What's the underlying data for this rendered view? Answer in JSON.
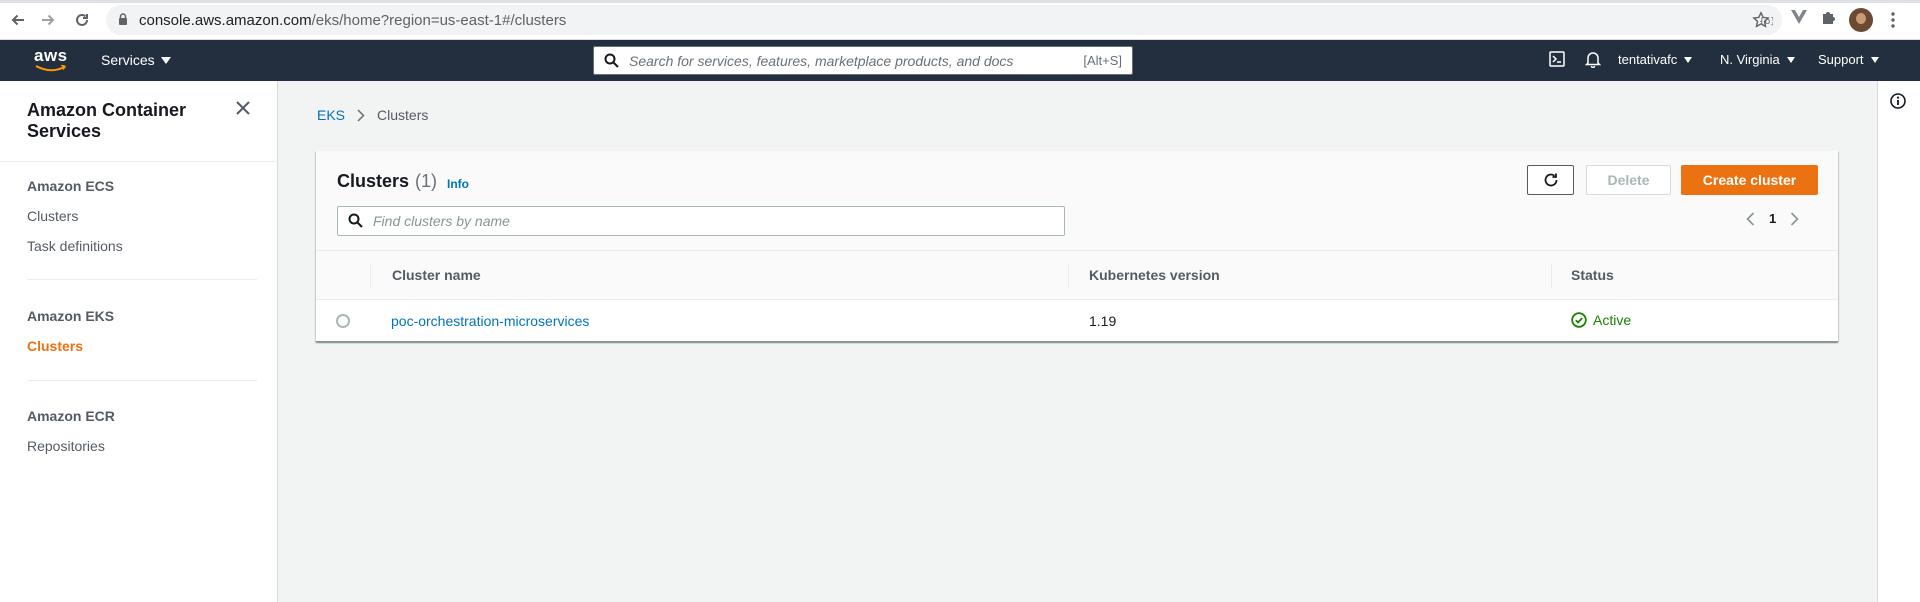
{
  "browser": {
    "url_host": "console.aws.amazon.com",
    "url_path": "/eks/home?region=us-east-1#/clusters"
  },
  "topnav": {
    "logo": "aws",
    "services_label": "Services",
    "search_placeholder": "Search for services, features, marketplace products, and docs",
    "search_shortcut": "[Alt+S]",
    "account_label": "tentativafc",
    "region_label": "N. Virginia",
    "support_label": "Support"
  },
  "sidebar": {
    "title": "Amazon Container Services",
    "sections": [
      {
        "heading": "Amazon ECS",
        "items": [
          "Clusters",
          "Task definitions"
        ]
      },
      {
        "heading": "Amazon EKS",
        "items": [
          "Clusters"
        ]
      },
      {
        "heading": "Amazon ECR",
        "items": [
          "Repositories"
        ]
      }
    ]
  },
  "breadcrumb": {
    "root": "EKS",
    "current": "Clusters"
  },
  "panel": {
    "title": "Clusters",
    "count": "(1)",
    "info_label": "Info",
    "delete_label": "Delete",
    "create_label": "Create cluster",
    "filter_placeholder": "Find clusters by name",
    "page_number": "1",
    "columns": [
      "Cluster name",
      "Kubernetes version",
      "Status"
    ],
    "rows": [
      {
        "name": "poc-orchestration-microservices",
        "version": "1.19",
        "status": "Active"
      }
    ]
  },
  "colors": {
    "nav_bg": "#232f3e",
    "accent_orange": "#ec7211",
    "link_blue": "#0073bb",
    "status_green": "#1d8102"
  },
  "icons": {
    "back": "arrow-left-icon",
    "forward": "arrow-right-icon",
    "reload": "reload-icon",
    "lock": "lock-icon",
    "bookmark": "star-icon",
    "search": "search-icon",
    "close": "close-icon",
    "refresh": "refresh-icon",
    "status_ok": "check-circle-icon"
  }
}
